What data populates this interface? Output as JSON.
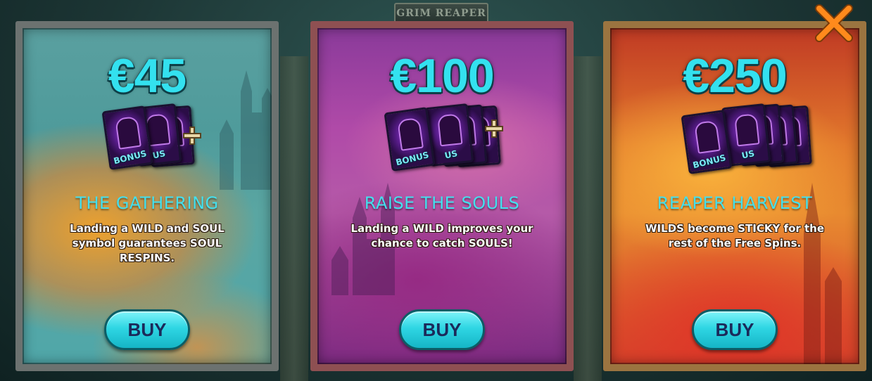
{
  "background": {
    "title": "GRIM REAPER"
  },
  "offers": [
    {
      "price": "€45",
      "bonus_label": "BONUS",
      "bonus_partial_label": "US",
      "title": "THE GATHERING",
      "description": "Landing a WILD and SOUL symbol guarantees SOUL RESPINS.",
      "button_label": "BUY"
    },
    {
      "price": "€100",
      "bonus_label": "BONUS",
      "bonus_partial_label": "US",
      "title": "RAISE THE SOULS",
      "description": "Landing a WILD improves your chance to catch SOULS!",
      "button_label": "BUY"
    },
    {
      "price": "€250",
      "bonus_label": "BONUS",
      "bonus_partial_label": "US",
      "title": "REAPER HARVEST",
      "description": "WILDS become STICKY for the rest of the Free Spins.",
      "button_label": "BUY"
    }
  ],
  "icons": {
    "close": "close-icon",
    "plus": "plus-icon",
    "bonus_card": "bonus-card-icon"
  },
  "colors": {
    "accent_cyan": "#33e1ef",
    "close_orange": "#ff8a1c"
  }
}
